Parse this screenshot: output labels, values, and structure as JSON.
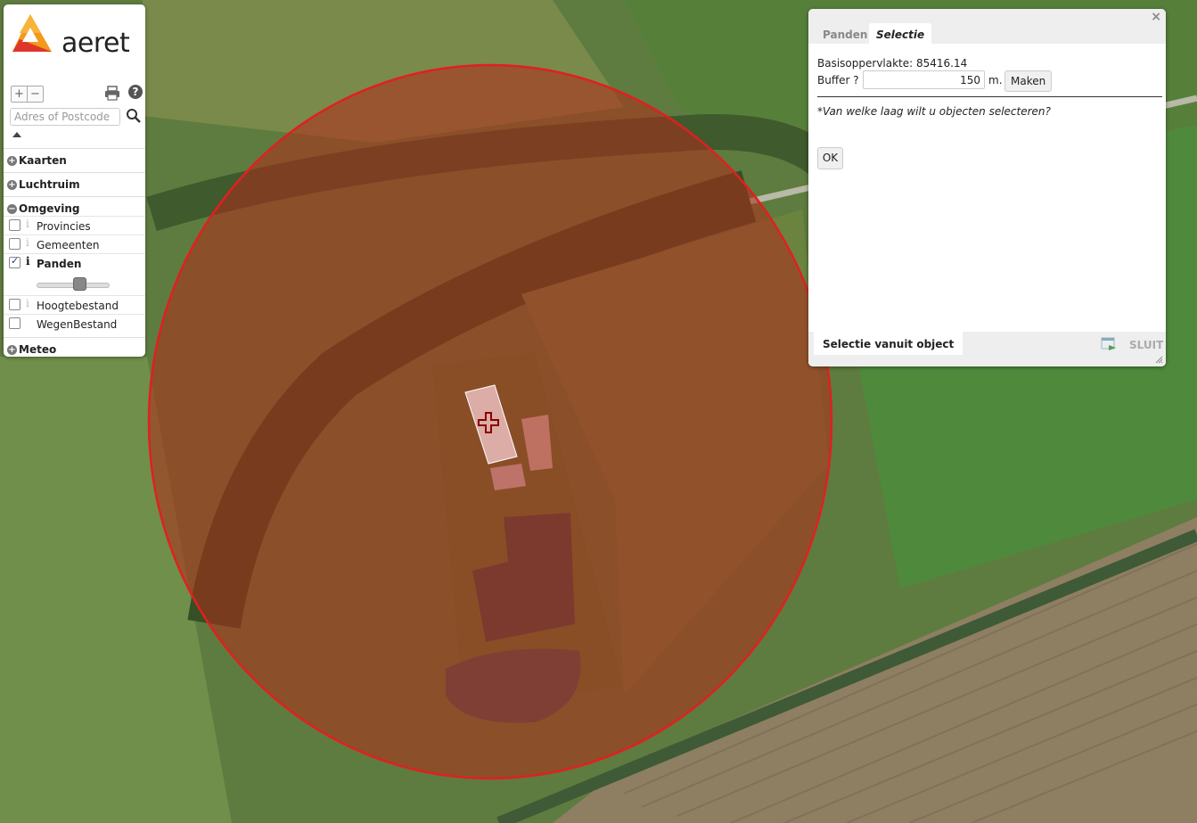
{
  "map": {
    "marker_icon": "crosshair-cross",
    "buffer_color": "#e02020"
  },
  "sidebar": {
    "logo_text": "aeret",
    "zoom_in": "+",
    "zoom_out": "−",
    "help": "?",
    "search_placeholder": "Adres of Postcode",
    "sections": [
      {
        "label": "Kaarten",
        "state": "collapsed"
      },
      {
        "label": "Luchtruim",
        "state": "collapsed"
      },
      {
        "label": "Omgeving",
        "state": "expanded"
      },
      {
        "label": "Meteo",
        "state": "collapsed"
      }
    ],
    "layers": [
      {
        "label": "Provincies",
        "checked": false
      },
      {
        "label": "Gemeenten",
        "checked": false
      },
      {
        "label": "Panden",
        "checked": true
      },
      {
        "label": "Hoogtebestand",
        "checked": false
      },
      {
        "label": "WegenBestand",
        "checked": false
      }
    ]
  },
  "dialog": {
    "tabs": [
      "Panden",
      "Selectie"
    ],
    "active_tab": "Selectie",
    "area_label": "Basisoppervlakte: 85416.14",
    "buffer_label": "Buffer ? :",
    "buffer_value": "150",
    "buffer_unit": "m.",
    "make_button": "Maken",
    "question": "*Van welke laag wilt u objecten selecteren?",
    "ok_button": "OK",
    "footer_tab": "Selectie vanuit object",
    "close_label": "SLUIT",
    "close_x": "×"
  }
}
